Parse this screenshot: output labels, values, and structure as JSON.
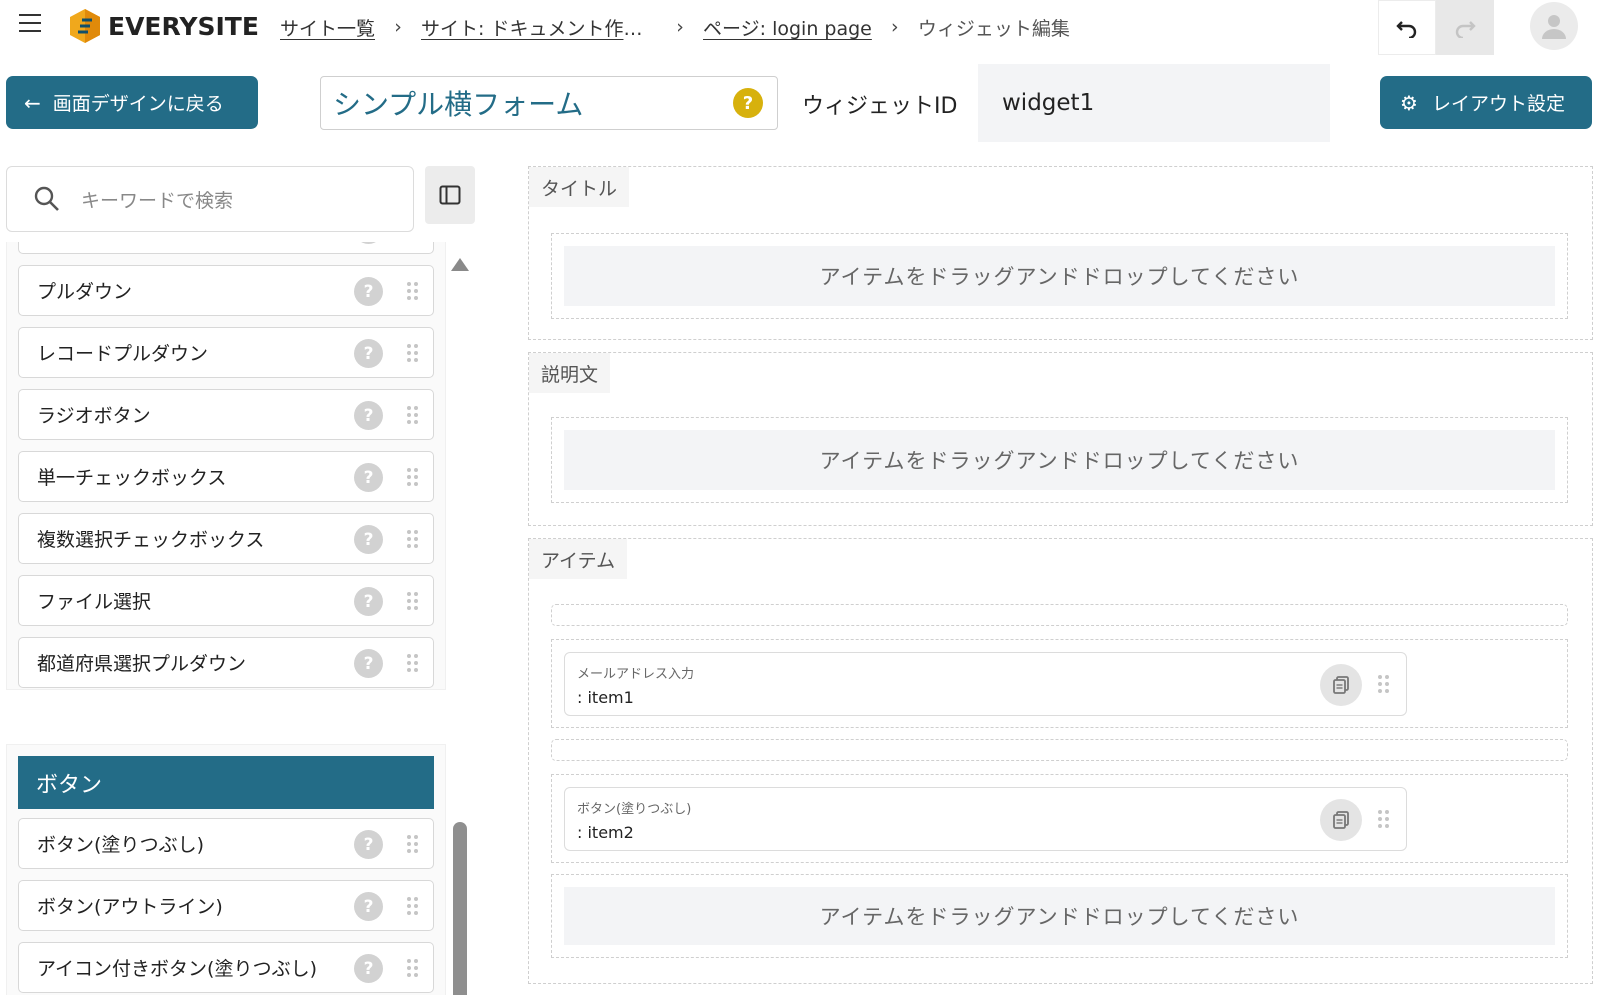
{
  "header": {
    "logo_text": "EVERYSITE",
    "breadcrumb": [
      {
        "label": "サイト一覧"
      },
      {
        "label": "サイト: ドキュメント作成用 ワークスペース"
      },
      {
        "label": "ページ: login page"
      },
      {
        "label": "ウィジェット編集"
      }
    ],
    "icons": {
      "menu": "hamburger-icon",
      "undo": "undo-icon",
      "redo": "redo-icon",
      "avatar": "user-icon"
    }
  },
  "toolbar": {
    "back_label": "画面デザインに戻る",
    "widget_name": "シンプル横フォーム",
    "widget_id_label": "ウィジェットID",
    "widget_id_value": "widget1",
    "layout_label": "レイアウト設定"
  },
  "sidebar": {
    "search_placeholder": "キーワードで検索",
    "items": [
      {
        "label": "プルダウン"
      },
      {
        "label": "レコードプルダウン"
      },
      {
        "label": "ラジオボタン"
      },
      {
        "label": "単一チェックボックス"
      },
      {
        "label": "複数選択チェックボックス"
      },
      {
        "label": "ファイル選択"
      },
      {
        "label": "都道府県選択プルダウン"
      }
    ],
    "section": "ボタン",
    "button_items": [
      {
        "label": "ボタン(塗りつぶし)"
      },
      {
        "label": "ボタン(アウトライン)"
      },
      {
        "label": "アイコン付きボタン(塗りつぶし)"
      }
    ],
    "help_glyph": "?"
  },
  "canvas": {
    "zones": [
      {
        "label": "タイトル"
      },
      {
        "label": "説明文"
      },
      {
        "label": "アイテム"
      }
    ],
    "drop_text": "アイテムをドラッグアンドドロップしてください",
    "cards": [
      {
        "type": "メールアドレス入力",
        "name": ": item1"
      },
      {
        "type": "ボタン(塗りつぶし)",
        "name": ": item2"
      }
    ]
  },
  "colors": {
    "primary": "#236c87",
    "help_yellow": "#d7b10d",
    "drop_bg": "#f3f4f6"
  }
}
